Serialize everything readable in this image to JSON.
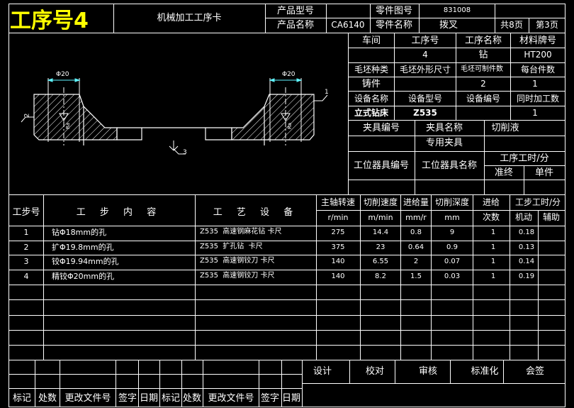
{
  "header": {
    "process_no": "工序号4",
    "card_title": "机械加工工序卡",
    "product_model_label": "产品型号",
    "part_drawing_no_label": "零件图号",
    "part_drawing_no": "831008",
    "product_name_label": "产品名称",
    "product_name": "CA6140",
    "part_name_label": "零件名称",
    "part_name": "拨叉",
    "total_pages": "共8页",
    "page_no": "第3页"
  },
  "info": {
    "workshop_label": "车间",
    "process_no_label": "工序号",
    "process_name_label": "工序名称",
    "material_label": "材料牌号",
    "process_no_value": "4",
    "process_name_value": "钻",
    "material_value": "HT200",
    "blank_type_label": "毛坯种类",
    "blank_size_label": "毛坯外形尺寸",
    "parts_per_blank_label": "毛坯可制件数",
    "parts_per_unit_label": "每台件数",
    "blank_type_value": "铸件",
    "parts_per_blank_value": "2",
    "parts_per_unit_value": "1",
    "equip_name_label": "设备名称",
    "equip_model_label": "设备型号",
    "equip_no_label": "设备编号",
    "simul_parts_label": "同时加工数",
    "equip_name_value": "立式钻床",
    "equip_model_value": "Z535",
    "simul_parts_value": "1",
    "fixture_no_label": "夹具编号",
    "fixture_name_label": "夹具名称",
    "coolant_label": "切削液",
    "fixture_name_value": "专用夹具",
    "station_tool_no_label": "工位器具编号",
    "station_tool_name_label": "工位器具名称",
    "process_time_label": "工序工时/分",
    "prep_end_label": "准终",
    "unit_label": "单件"
  },
  "drawing": {
    "dim_left": "Φ20",
    "dim_right": "Φ20",
    "callout_1": "1",
    "callout_2": "2",
    "callout_3": "3",
    "roughness": "Ra"
  },
  "steps_header": {
    "step_no": "工步号",
    "content": "工 步 内 容",
    "equipment": "工 艺 设 备",
    "spindle_speed": "主轴转速",
    "cutting_speed": "切削速度",
    "feed": "进给量",
    "depth": "切削深度",
    "passes": "进给",
    "passes2": "次数",
    "step_time": "工步工时/分",
    "unit_speed": "r/min",
    "unit_cut": "m/min",
    "unit_feed": "mm/r",
    "unit_depth": "mm",
    "machine": "机动",
    "aux": "辅助"
  },
  "steps": [
    {
      "no": "1",
      "content": "钻Φ18mm的孔",
      "equip": "Z535  高速钢麻花钻 卡尺",
      "speed": "275",
      "cut": "14.4",
      "feed": "0.8",
      "depth": "9",
      "passes": "1",
      "time": "0.18"
    },
    {
      "no": "2",
      "content": "扩Φ19.8mm的孔",
      "equip": "Z535  扩孔钻  卡尺",
      "speed": "375",
      "cut": "23",
      "feed": "0.64",
      "depth": "0.9",
      "passes": "1",
      "time": "0.13"
    },
    {
      "no": "3",
      "content": "铰Φ19.94mm的孔",
      "equip": "Z535  高速钢铰刀 卡尺",
      "speed": "140",
      "cut": "6.55",
      "feed": "2",
      "depth": "0.07",
      "passes": "1",
      "time": "0.14"
    },
    {
      "no": "4",
      "content": "精铰Φ20mm的孔",
      "equip": "Z535  高速钢铰刀 卡尺",
      "speed": "140",
      "cut": "8.2",
      "feed": "1.5",
      "depth": "0.03",
      "passes": "1",
      "time": "0.19"
    }
  ],
  "signoff": {
    "design": "设计",
    "check": "校对",
    "review": "审核",
    "standard": "标准化",
    "countersign": "会签"
  },
  "revision": {
    "mark": "标记",
    "count": "处数",
    "doc_no": "更改文件号",
    "sign": "签字",
    "date": "日期"
  },
  "colors": {
    "background": "#000000",
    "lines": "#ffffff",
    "title": "#ffff00",
    "hatch": "#ffffff",
    "dim": "#5ff5ff"
  }
}
